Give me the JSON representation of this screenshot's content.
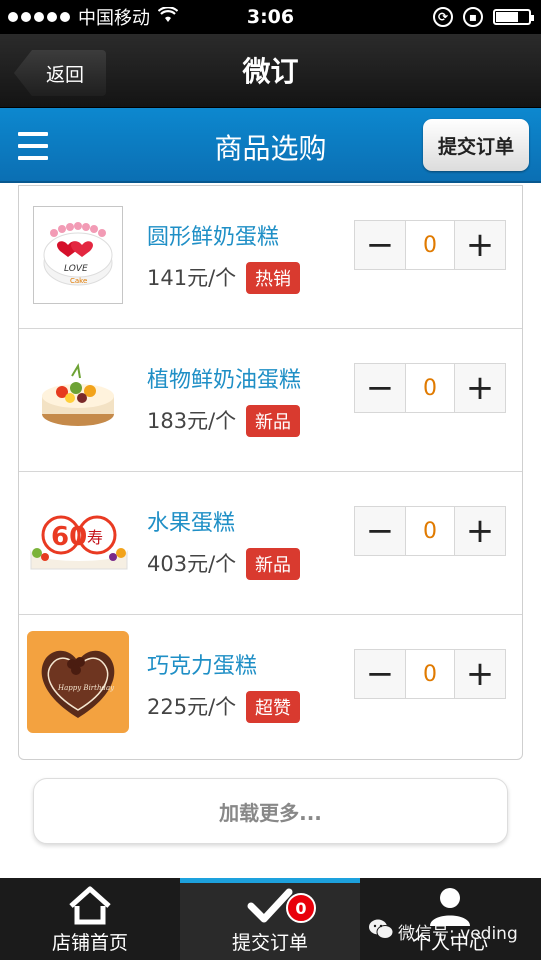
{
  "status_bar": {
    "carrier": "中国移动",
    "time": "3:06"
  },
  "nav": {
    "back_label": "返回",
    "title": "微订"
  },
  "header": {
    "title": "商品选购",
    "submit_label": "提交订单"
  },
  "products": [
    {
      "name": "圆形鲜奶蛋糕",
      "price": "141元/个",
      "tag": "热销",
      "quantity": "0"
    },
    {
      "name": "植物鲜奶油蛋糕",
      "price": "183元/个",
      "tag": "新品",
      "quantity": "0"
    },
    {
      "name": "水果蛋糕",
      "price": "403元/个",
      "tag": "新品",
      "quantity": "0"
    },
    {
      "name": "巧克力蛋糕",
      "price": "225元/个",
      "tag": "超赞",
      "quantity": "0"
    }
  ],
  "stepper": {
    "minus": "−",
    "plus": "+"
  },
  "load_more": "加载更多...",
  "thumb_text": {
    "love": "LOVE",
    "cake_brand": "Cake",
    "fruit_number": "60",
    "fruit_char": "寿",
    "choco_text": "Happy Birthday"
  },
  "tabs": [
    {
      "label": "店铺首页",
      "icon": "home-icon"
    },
    {
      "label": "提交订单",
      "icon": "check-icon",
      "badge": "0"
    },
    {
      "label": "个人中心",
      "icon": "user-icon"
    }
  ],
  "watermark": "微信号: veding",
  "colors": {
    "header_blue": "#0b78c0",
    "name_blue": "#1f8fc6",
    "tag_red": "#d93a2f",
    "quantity_orange": "#e07a00",
    "tab_active": "#1da1dd"
  }
}
